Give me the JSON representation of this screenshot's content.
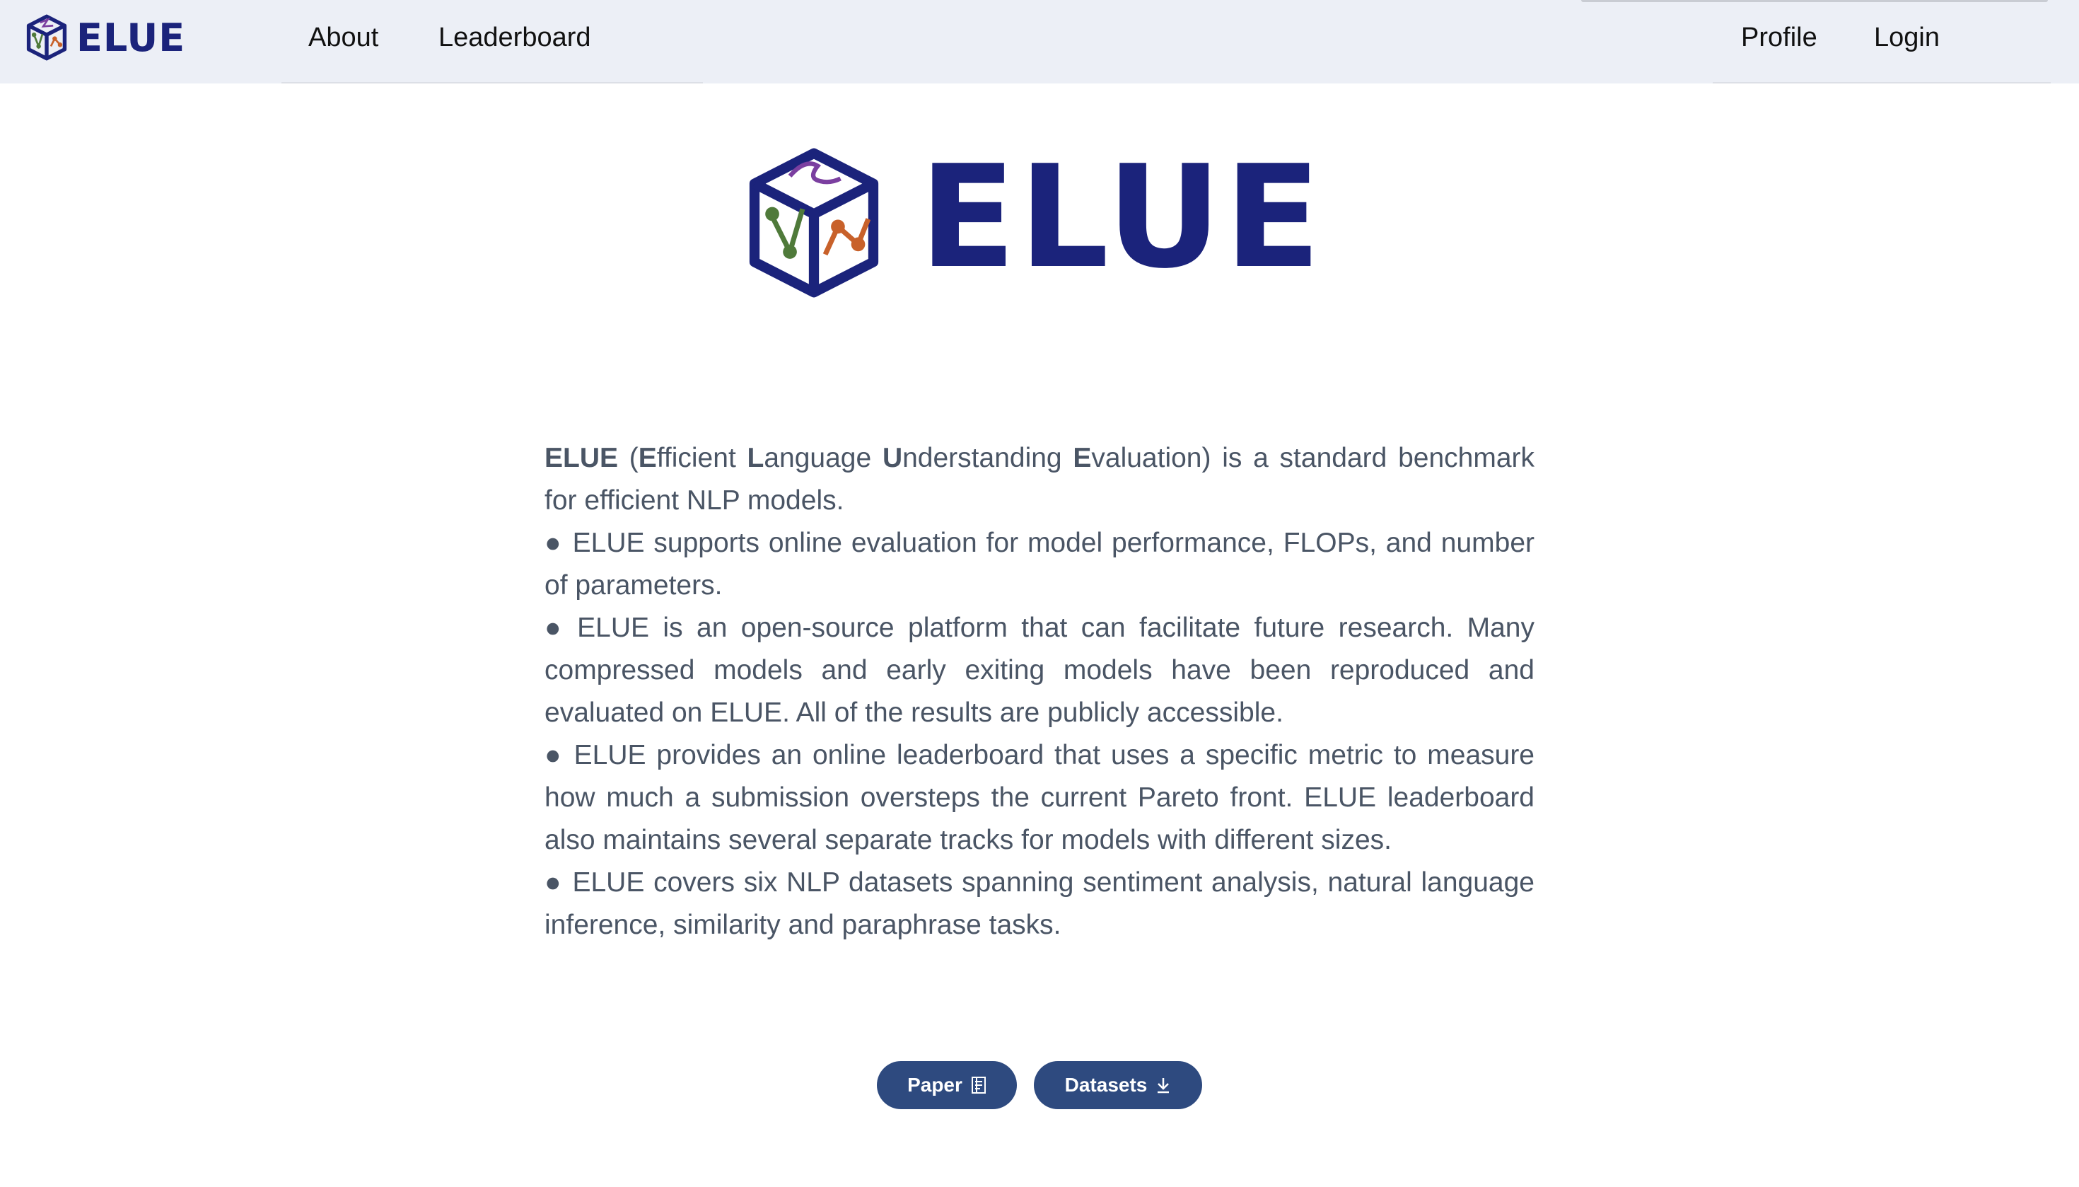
{
  "header": {
    "brand": "ELUE",
    "nav_left": [
      {
        "label": "About"
      },
      {
        "label": "Leaderboard"
      }
    ],
    "nav_right": [
      {
        "label": "Profile"
      },
      {
        "label": "Login"
      }
    ]
  },
  "hero": {
    "title": "ELUE"
  },
  "intro": {
    "lead_bold": "ELUE",
    "lead_open": " (",
    "e_bold": "E",
    "e_rest": "fficient ",
    "l_bold": "L",
    "l_rest": "anguage ",
    "u_bold": "U",
    "u_rest": "nderstanding ",
    "e2_bold": "E",
    "e2_rest": "valuation) is a standard benchmark for efficient NLP models.",
    "bullet_char": "●",
    "bullets": [
      "ELUE supports online evaluation for model performance, FLOPs, and number of parameters.",
      "ELUE is an open-source platform that can facilitate future research. Many compressed models and early exiting models have been reproduced and evaluated on ELUE. All of the results are publicly accessible.",
      "ELUE provides an online leaderboard that uses a specific metric to measure how much a submission oversteps the current Pareto front. ELUE leaderboard also maintains several separate tracks for models with different sizes.",
      "ELUE covers six NLP datasets spanning sentiment analysis, natural language inference, similarity and paraphrase tasks."
    ]
  },
  "buttons": {
    "paper": {
      "label": "Paper",
      "icon": "document-icon"
    },
    "datasets": {
      "label": "Datasets",
      "icon": "download-icon"
    }
  },
  "colors": {
    "brand_navy": "#1b237b",
    "header_bg": "#eceff6",
    "button_bg": "#2e4a7f",
    "body_text": "#4a5565",
    "logo_purple": "#7b3fa0",
    "logo_green": "#4f7a3a",
    "logo_orange": "#c8612a"
  }
}
